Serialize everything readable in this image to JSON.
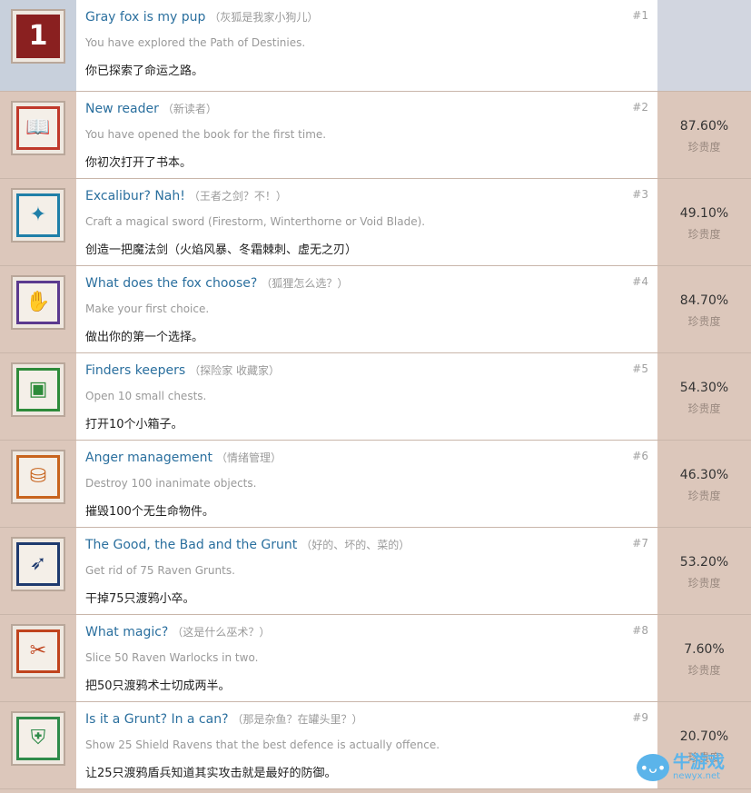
{
  "achievements": [
    {
      "title": "Gray fox is my pup",
      "title_cn": "（灰狐是我家小狗儿）",
      "desc": "You have explored the Path of Destinies.",
      "desc_cn": "你已探索了命运之路。",
      "num": "#1",
      "percent": "",
      "rarity_label": "",
      "icon": "number-one-icon",
      "glyph": "1",
      "color": "#8a2020"
    },
    {
      "title": "New reader",
      "title_cn": "（新读者）",
      "desc": "You have opened the book for the first time.",
      "desc_cn": "你初次打开了书本。",
      "num": "#2",
      "percent": "87.60%",
      "rarity_label": "珍贵度",
      "icon": "book-icon",
      "glyph": "📖",
      "color": "#c0392b"
    },
    {
      "title": "Excalibur? Nah!",
      "title_cn": "（王者之剑？不！）",
      "desc": "Craft a magical sword (Firestorm, Winterthorne or Void Blade).",
      "desc_cn": "创造一把魔法剑（火焰风暴、冬霜棘刺、虚无之刃）",
      "num": "#3",
      "percent": "49.10%",
      "rarity_label": "珍贵度",
      "icon": "crystal-sword-icon",
      "glyph": "✦",
      "color": "#1f7fa8"
    },
    {
      "title": "What does the fox choose?",
      "title_cn": "（狐狸怎么选？）",
      "desc": "Make your first choice.",
      "desc_cn": "做出你的第一个选择。",
      "num": "#4",
      "percent": "84.70%",
      "rarity_label": "珍贵度",
      "icon": "hands-icon",
      "glyph": "✋",
      "color": "#5b3a8f"
    },
    {
      "title": "Finders keepers",
      "title_cn": "（探险家 收藏家）",
      "desc": "Open 10 small chests.",
      "desc_cn": "打开10个小箱子。",
      "num": "#5",
      "percent": "54.30%",
      "rarity_label": "珍贵度",
      "icon": "chest-icon",
      "glyph": "▣",
      "color": "#2e8b3a"
    },
    {
      "title": "Anger management",
      "title_cn": "（情绪管理）",
      "desc": "Destroy 100 inanimate objects.",
      "desc_cn": "摧毁100个无生命物件。",
      "num": "#6",
      "percent": "46.30%",
      "rarity_label": "珍贵度",
      "icon": "barrel-icon",
      "glyph": "⛁",
      "color": "#c8641e"
    },
    {
      "title": "The Good, the Bad and the Grunt",
      "title_cn": "（好的、坏的、菜的）",
      "desc": "Get rid of 75 Raven Grunts.",
      "desc_cn": "干掉75只渡鸦小卒。",
      "num": "#7",
      "percent": "53.20%",
      "rarity_label": "珍贵度",
      "icon": "raven-icon",
      "glyph": "➶",
      "color": "#1e3a6e"
    },
    {
      "title": "What magic?",
      "title_cn": "（这是什么巫术？）",
      "desc": "Slice 50 Raven Warlocks in two.",
      "desc_cn": "把50只渡鸦术士切成两半。",
      "num": "#8",
      "percent": "7.60%",
      "rarity_label": "珍贵度",
      "icon": "warlock-icon",
      "glyph": "✂",
      "color": "#c0441e"
    },
    {
      "title": "Is it a Grunt? In a can?",
      "title_cn": "（那是杂鱼？在罐头里？）",
      "desc": "Show 25 Shield Ravens that the best defence is actually offence.",
      "desc_cn": "让25只渡鸦盾兵知道其实攻击就是最好的防御。",
      "num": "#9",
      "percent": "20.70%",
      "rarity_label": "珍贵度",
      "icon": "shield-can-icon",
      "glyph": "⛨",
      "color": "#2e8b4a"
    }
  ],
  "watermark": {
    "name": "牛游戏",
    "url": "newyx.net",
    "icon": "mascot-icon"
  }
}
